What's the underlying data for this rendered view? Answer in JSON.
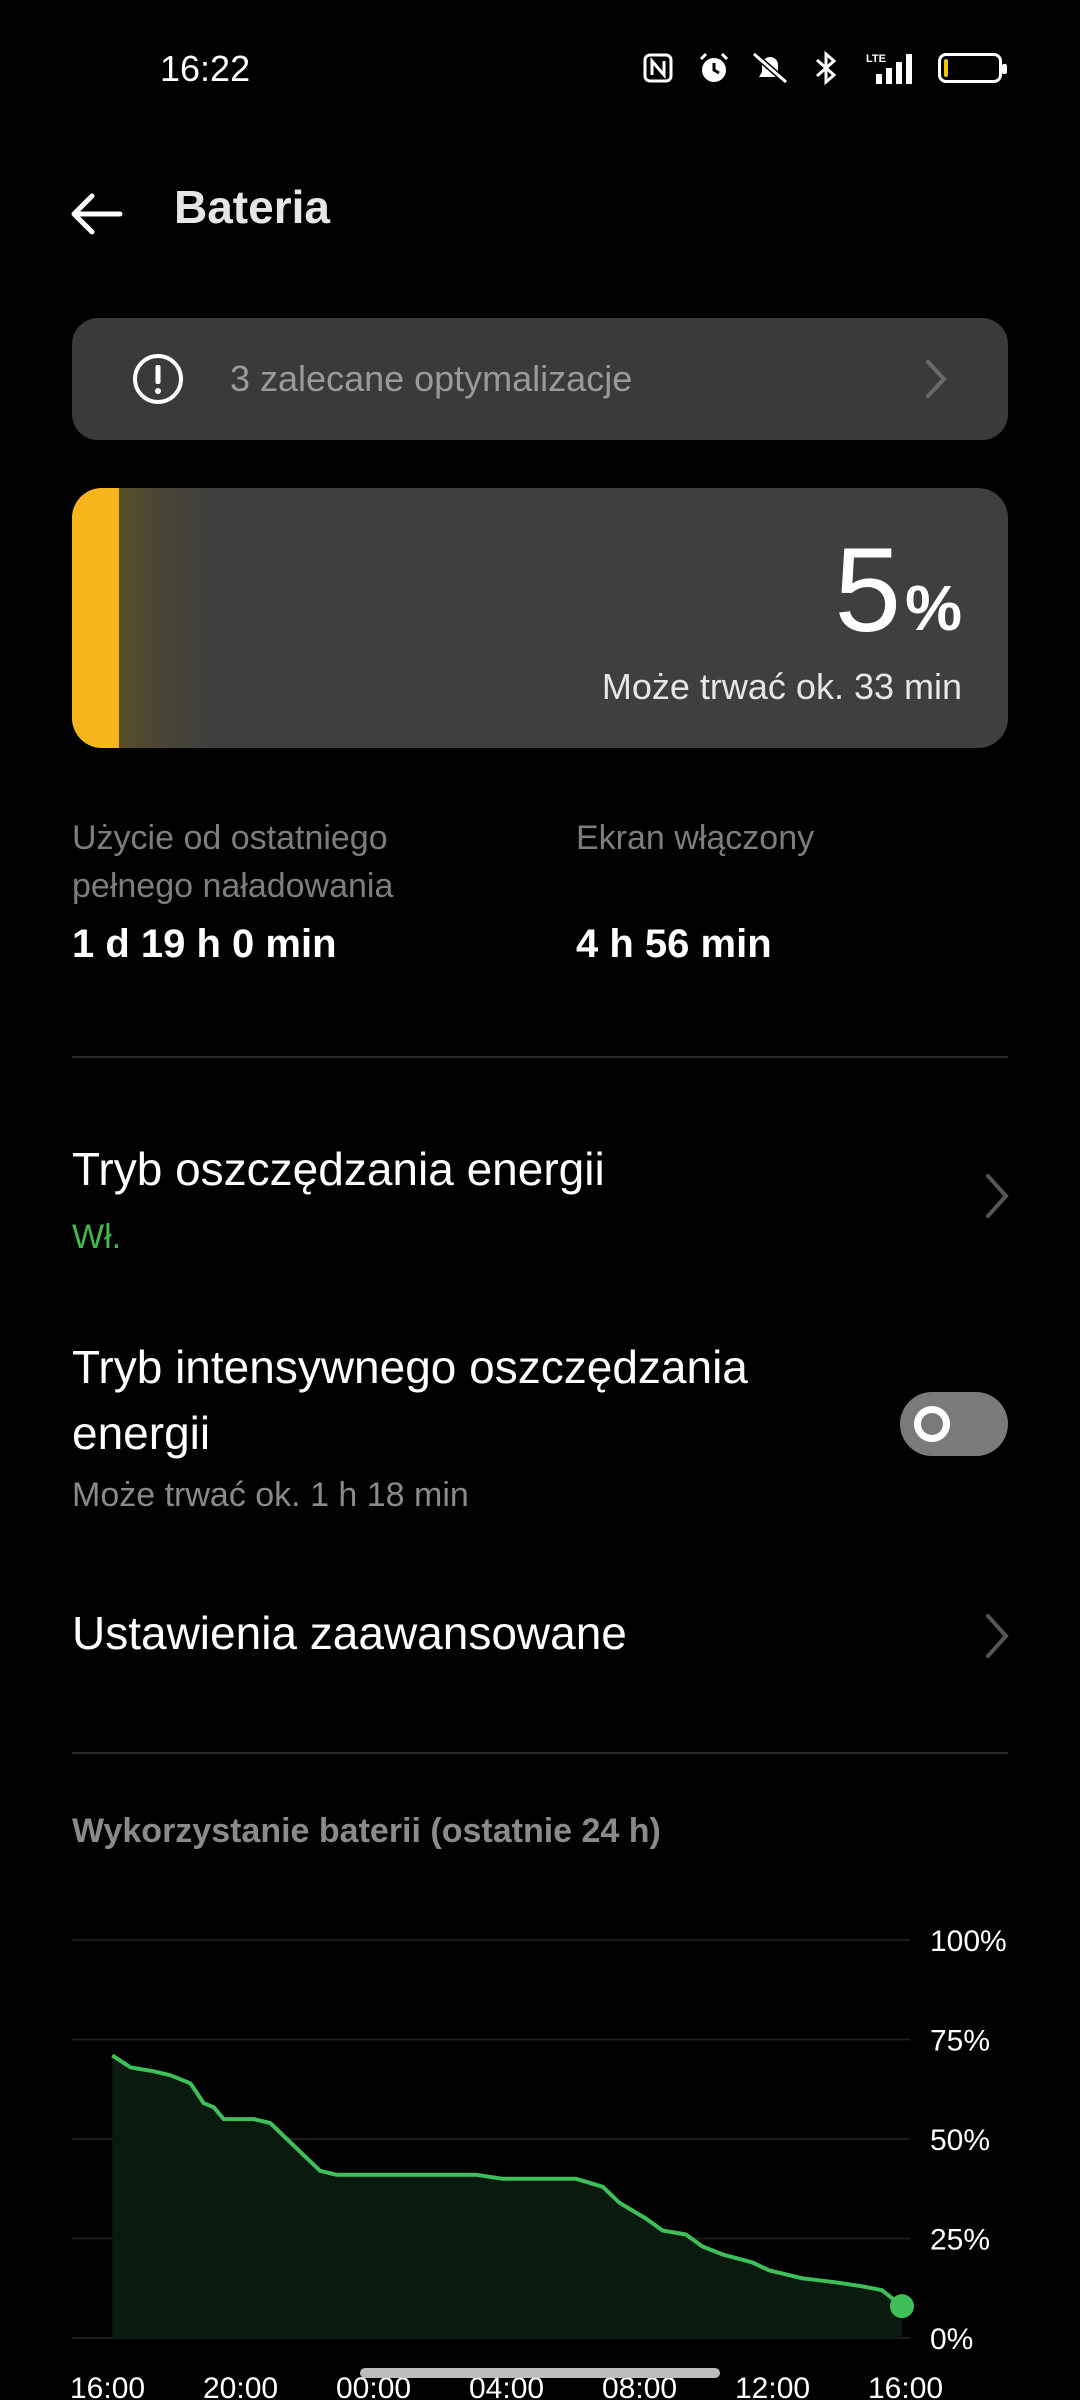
{
  "status": {
    "time": "16:22",
    "battery_level_percent": 5,
    "icons": [
      "nfc-icon",
      "alarm-icon",
      "mute-icon",
      "bluetooth-icon",
      "lte-signal-icon",
      "battery-icon"
    ],
    "lte": "LTE"
  },
  "header": {
    "title": "Bateria"
  },
  "optimization": {
    "label": "3 zalecane optymalizacje"
  },
  "battery": {
    "percent_number": "5",
    "percent_sign": "%",
    "level": 5,
    "estimate": "Może trwać ok. 33 min",
    "color": "#f5b51b"
  },
  "usage": {
    "since_charge_label_1": "Użycie od ostatniego",
    "since_charge_label_2": "pełnego naładowania",
    "since_charge_value": "1 d 19 h 0 min",
    "screen_on_label": "Ekran włączony",
    "screen_on_value": "4 h 56 min"
  },
  "settings": {
    "power_saving": {
      "title": "Tryb oszczędzania energii",
      "status": "Wł.",
      "status_color": "#3fb950"
    },
    "super_saving": {
      "title_line1": "Tryb intensywnego oszczędzania",
      "title_line2": "energii",
      "subtitle": "Może trwać ok. 1 h 18 min",
      "enabled": false
    },
    "advanced": {
      "title": "Ustawienia zaawansowane"
    }
  },
  "chart_data": {
    "type": "area",
    "title": "Wykorzystanie baterii (ostatnie 24 h)",
    "x_ticks": [
      "16:00",
      "20:00",
      "00:00",
      "04:00",
      "08:00",
      "12:00",
      "16:00"
    ],
    "y_ticks": [
      "100%",
      "75%",
      "50%",
      "25%",
      "0%"
    ],
    "ylim": [
      0,
      100
    ],
    "xlim": [
      0,
      24
    ],
    "line_color": "#3fbf5a",
    "series": [
      {
        "x": [
          0.25,
          0.8,
          1.5,
          2.0,
          2.3,
          2.6,
          3.0,
          3.3,
          3.6,
          4.0,
          4.5,
          5.0,
          5.5,
          6.0,
          6.5,
          7.0,
          8.0,
          9.0,
          10.5,
          11.2,
          12.0,
          13.0,
          13.8,
          14.2,
          15.0,
          15.5,
          16.3,
          16.8,
          17.5,
          18.0,
          18.6,
          19.5,
          20.0,
          21.0,
          22.0,
          22.8,
          23.4,
          24.0
        ],
        "y": [
          71,
          68,
          67,
          66,
          65,
          64,
          59,
          58,
          55,
          55,
          55,
          54,
          50,
          46,
          42,
          41,
          41,
          41,
          41,
          41,
          40,
          40,
          40,
          40,
          38,
          34,
          30,
          27,
          26,
          23,
          21,
          19,
          17,
          15,
          14,
          13,
          12,
          8
        ]
      }
    ]
  }
}
